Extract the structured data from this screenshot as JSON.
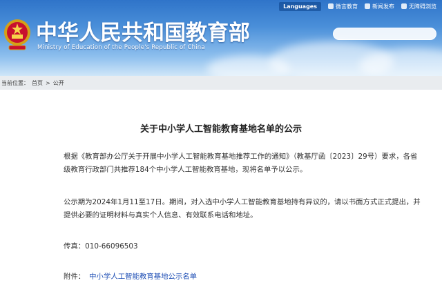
{
  "topbar": {
    "language": "Languages",
    "link1": "微言教育",
    "link2": "新闻发布",
    "link3": "无障碍浏览"
  },
  "header": {
    "title_cn": "中华人民共和国教育部",
    "title_en": "Ministry of Education of the People's Republic of China"
  },
  "breadcrumb": {
    "label": "当前位置：",
    "home": "首页",
    "separator": ">",
    "current": "公开"
  },
  "document": {
    "title": "关于中小学人工智能教育基地名单的公示",
    "para1": "根据《教育部办公厅关于开展中小学人工智能教育基地推荐工作的通知》（教基厅函〔2023〕29号）要求，各省级教育行政部门共推荐184个中小学人工智能教育基地，现将名单予以公示。",
    "para2": "公示期为2024年1月11至17日。期间，对入选中小学人工智能教育基地持有异议的，请以书面方式正式提出，并提供必要的证明材料与真实个人信息、有效联系电话和地址。",
    "fax": "传真：010-66096503",
    "attachment_label": "附件：",
    "attachment_link": "中小学人工智能教育基地公示名单"
  }
}
